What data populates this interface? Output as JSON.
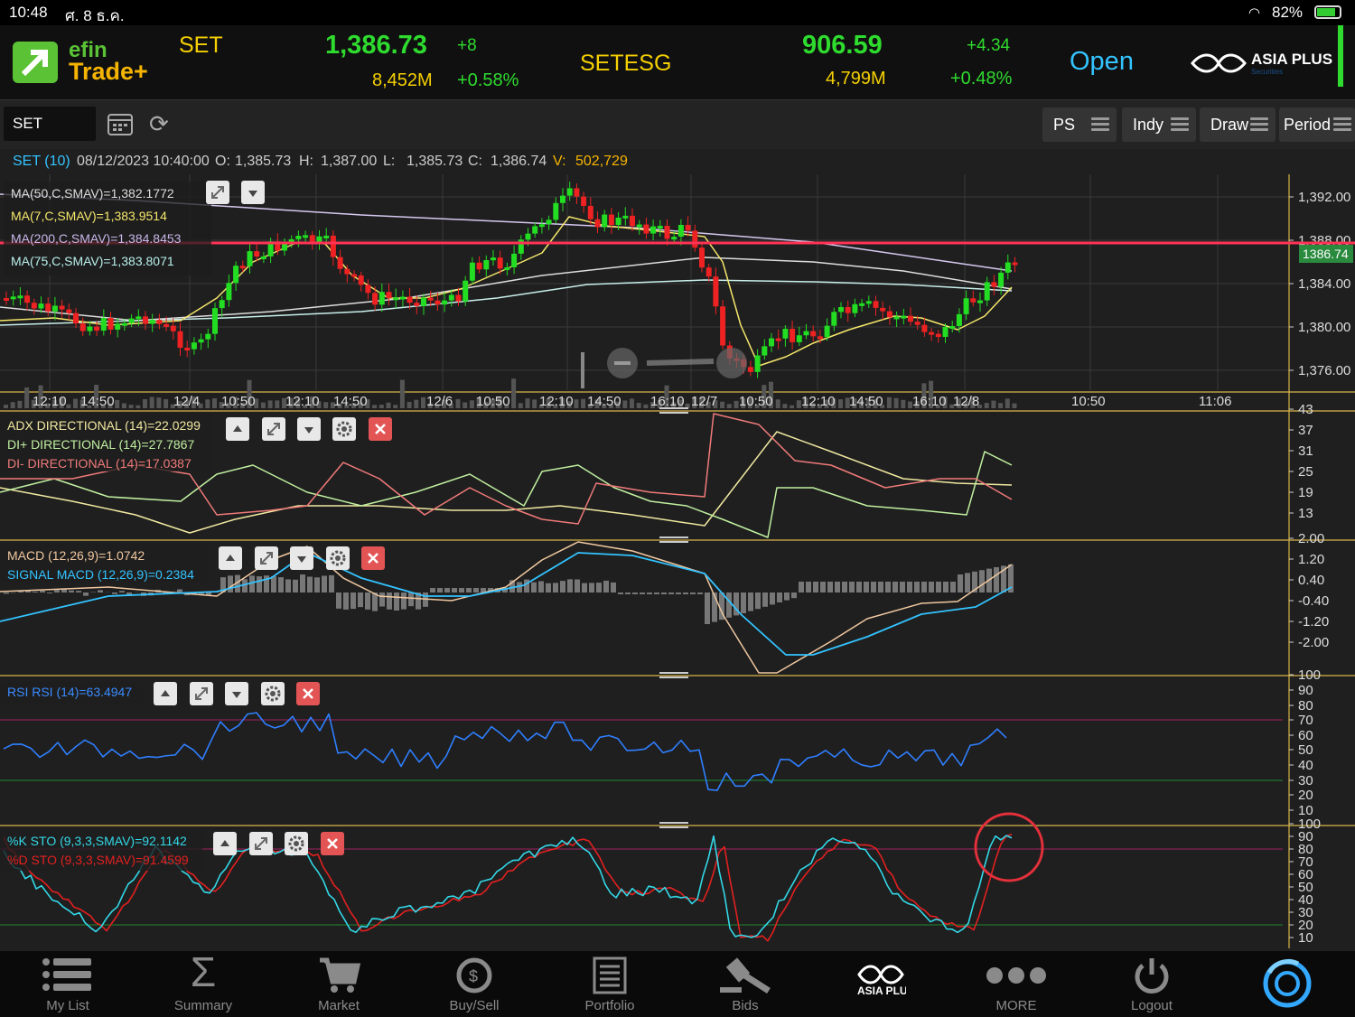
{
  "status": {
    "time": "10:48",
    "date": "ศ. 8 ธ.ค.",
    "battery": "82%"
  },
  "header": {
    "brand_line1": "efin",
    "brand_line2": "Trade+",
    "set_name": "SET",
    "set_value": "1,386.73",
    "set_change": "+8",
    "set_volume": "8,452M",
    "set_change_pct": "+0.58%",
    "esg_name": "SETESG",
    "esg_value": "906.59",
    "esg_change": "+4.34",
    "esg_volume": "4,799M",
    "esg_change_pct": "+0.48%",
    "market_status": "Open",
    "partner": "ASIA PLUS",
    "partner_sub": "Securities"
  },
  "toolbar": {
    "symbol": "SET",
    "buttons": [
      "PS",
      "Indy",
      "Draw",
      "Period"
    ]
  },
  "infobar": {
    "symbol": "SET (10)",
    "datetime": "08/12/2023 10:40:00",
    "o_label": "O:",
    "o": "1,385.73",
    "h_label": "H:",
    "h": "1,387.00",
    "l_label": "L:",
    "l": "1,385.73",
    "c_label": "C:",
    "c": "1,386.74",
    "v_label": "V:",
    "v": "502,729"
  },
  "price_panel": {
    "ma_labels": [
      "MA(50,C,SMAV)=1,382.1772",
      "MA(7,C,SMAV)=1,383.9514",
      "MA(200,C,SMAV)=1,384.8453",
      "MA(75,C,SMAV)=1,383.8071"
    ],
    "y_ticks": [
      "1,392.00",
      "1,388.00",
      "1,384.00",
      "1,380.00",
      "1,376.00"
    ],
    "last_price": "1386.74",
    "time_labels": [
      "12:10",
      "14:50",
      "12/4",
      "10:50",
      "12:10",
      "14:50",
      "12/6",
      "10:50",
      "12:10",
      "14:50",
      "16:10",
      "12/7",
      "10:50",
      "12:10",
      "14:50",
      "16:10",
      "12/8",
      "10:50",
      "11:06"
    ]
  },
  "adx_panel": {
    "labels": [
      "ADX DIRECTIONAL (14)=22.0299",
      "DI+ DIRECTIONAL (14)=27.7867",
      "DI- DIRECTIONAL (14)=17.0387"
    ],
    "y_ticks": [
      "43",
      "37",
      "31",
      "25",
      "19",
      "13"
    ]
  },
  "macd_panel": {
    "labels": [
      "MACD (12,26,9)=1.0742",
      "SIGNAL MACD (12,26,9)=0.2384"
    ],
    "y_ticks": [
      "2.00",
      "1.20",
      "0.40",
      "-0.40",
      "-1.20",
      "-2.00"
    ]
  },
  "rsi_panel": {
    "labels": [
      "RSI RSI (14)=63.4947"
    ],
    "y_ticks": [
      "100",
      "90",
      "80",
      "70",
      "60",
      "50",
      "40",
      "30",
      "20",
      "10"
    ]
  },
  "sto_panel": {
    "labels": [
      "%K STO (9,3,3,SMAV)=92.1142",
      "%D STO (9,3,3,SMAV)=91.4599"
    ],
    "y_ticks": [
      "100",
      "90",
      "80",
      "70",
      "60",
      "50",
      "40",
      "30",
      "20",
      "10"
    ]
  },
  "tabs": [
    {
      "label": "My List",
      "icon": "list-icon"
    },
    {
      "label": "Summary",
      "icon": "sigma-icon"
    },
    {
      "label": "Market",
      "icon": "cart-icon"
    },
    {
      "label": "Buy/Sell",
      "icon": "buysell-icon"
    },
    {
      "label": "Portfolio",
      "icon": "document-icon"
    },
    {
      "label": "Bids",
      "icon": "gavel-icon"
    },
    {
      "label": "",
      "icon": "asiaplus-logo-icon"
    },
    {
      "label": "MORE",
      "icon": "more-dots-icon"
    },
    {
      "label": "Logout",
      "icon": "power-icon"
    },
    {
      "label": "",
      "icon": "refresh-circle-icon"
    }
  ],
  "colors": {
    "up": "#22dd22",
    "down": "#ee2222",
    "accent": "#33c3ff",
    "hline": "#ff3355"
  }
}
